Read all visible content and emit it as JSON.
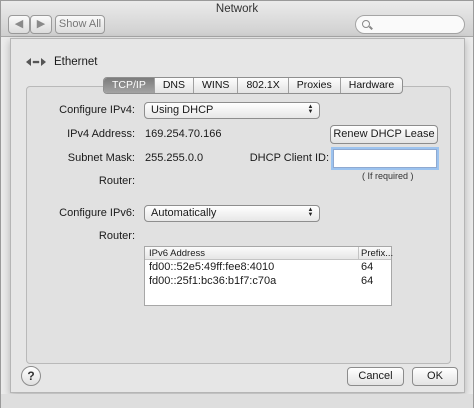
{
  "window": {
    "title": "Network",
    "show_all": "Show All",
    "back": "◀",
    "forward": "▶"
  },
  "sheet": {
    "interface": "Ethernet",
    "tabs": [
      {
        "label": "TCP/IP",
        "active": true
      },
      {
        "label": "DNS"
      },
      {
        "label": "WINS"
      },
      {
        "label": "802.1X"
      },
      {
        "label": "Proxies"
      },
      {
        "label": "Hardware"
      }
    ],
    "ipv4": {
      "configure_label": "Configure IPv4:",
      "configure_value": "Using DHCP",
      "address_label": "IPv4 Address:",
      "address_value": "169.254.70.166",
      "mask_label": "Subnet Mask:",
      "mask_value": "255.255.0.0",
      "router_label": "Router:",
      "renew_button": "Renew DHCP Lease",
      "client_id_label": "DHCP Client ID:",
      "client_id_value": "",
      "client_id_hint": "( If required )"
    },
    "ipv6": {
      "configure_label": "Configure IPv6:",
      "configure_value": "Automatically",
      "router_label": "Router:",
      "table": {
        "columns": [
          "IPv6 Address",
          "Prefix..."
        ],
        "rows": [
          {
            "address": "fd00::52e5:49ff:fee8:4010",
            "prefix": "64"
          },
          {
            "address": "fd00::25f1:bc36:b1f7:c70a",
            "prefix": "64"
          }
        ]
      }
    },
    "help": "?",
    "cancel_button": "Cancel",
    "ok_button": "OK"
  },
  "colors": {
    "focus_ring": "#9cc3ef",
    "active_tab": "#8c8c8c"
  }
}
